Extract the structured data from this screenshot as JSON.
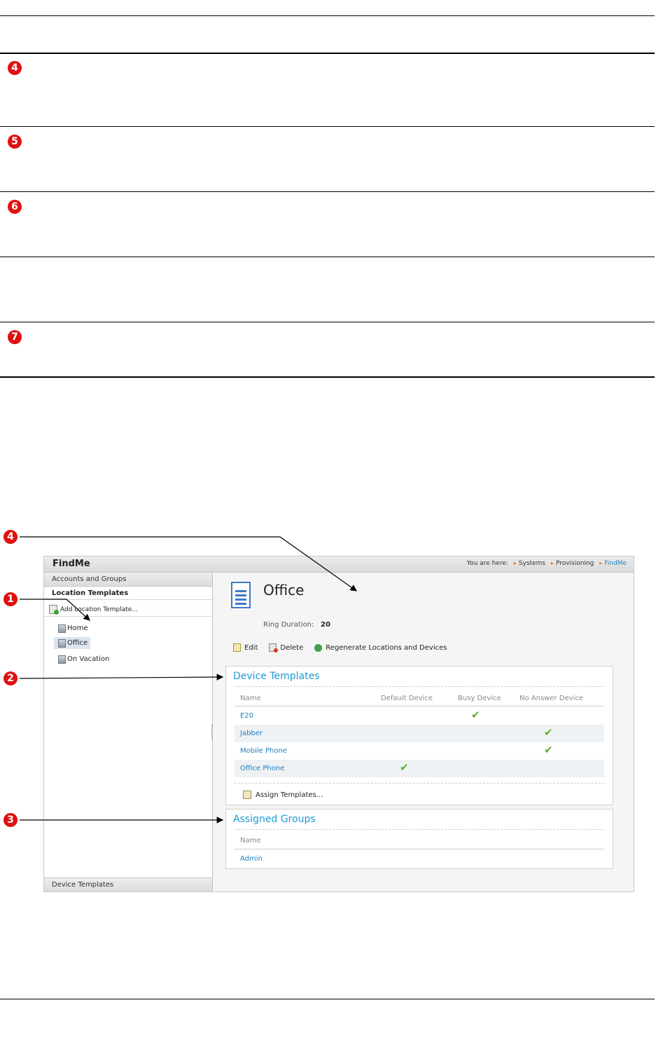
{
  "callouts": {
    "row4": "4",
    "row5": "5",
    "row6": "6",
    "row7": "7",
    "fig_1": "1",
    "fig_2": "2",
    "fig_3": "3",
    "fig_4": "4"
  },
  "app": {
    "title": "FindMe",
    "breadcrumb_prefix": "You are here:",
    "breadcrumb": [
      "Systems",
      "Provisioning",
      "FindMe"
    ]
  },
  "sidebar": {
    "section_top": "Accounts and Groups",
    "section_active": "Location Templates",
    "add_label": "Add Location Template...",
    "items": [
      "Home",
      "Office",
      "On Vacation"
    ],
    "selected": "Office",
    "section_bottom": "Device Templates"
  },
  "main": {
    "title": "Office",
    "ring_duration_label": "Ring Duration:",
    "ring_duration_value": "20",
    "actions": {
      "edit": "Edit",
      "delete": "Delete",
      "regenerate": "Regenerate Locations and Devices"
    },
    "device_templates": {
      "title": "Device Templates",
      "columns": [
        "Name",
        "Default Device",
        "Busy Device",
        "No Answer Device"
      ],
      "rows": [
        {
          "name": "E20",
          "default": false,
          "busy": true,
          "no_answer": false
        },
        {
          "name": "Jabber",
          "default": false,
          "busy": false,
          "no_answer": true
        },
        {
          "name": "Mobile Phone",
          "default": false,
          "busy": false,
          "no_answer": true
        },
        {
          "name": "Office Phone",
          "default": true,
          "busy": false,
          "no_answer": false
        }
      ],
      "assign_label": "Assign Templates..."
    },
    "assigned_groups": {
      "title": "Assigned Groups",
      "column": "Name",
      "rows": [
        "Admin"
      ]
    }
  },
  "colors": {
    "callout_red": "#e01010",
    "link_blue": "#1f7fbf",
    "heading_blue": "#1b9bd4",
    "check_green": "#5cb02c"
  }
}
